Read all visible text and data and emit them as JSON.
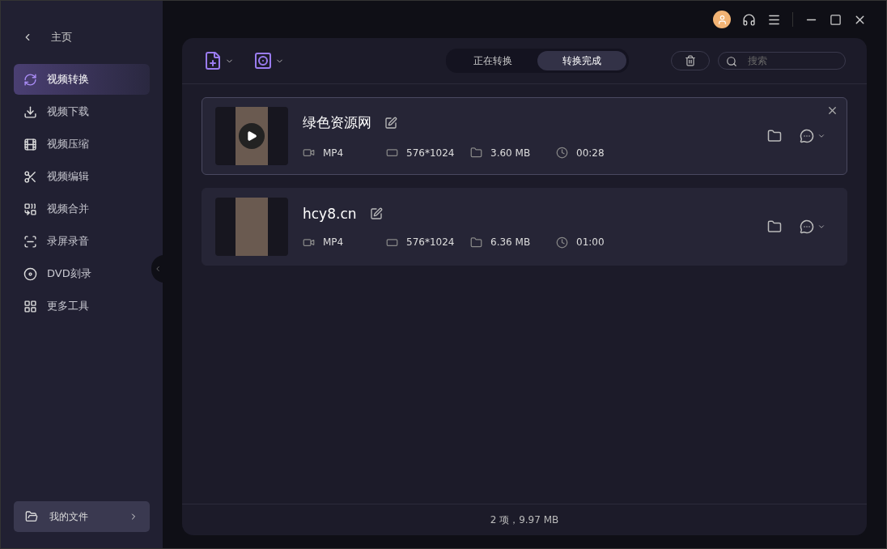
{
  "sidebar": {
    "back": {
      "label": "主页"
    },
    "items": [
      {
        "label": "视频转换",
        "selected": true
      },
      {
        "label": "视频下载",
        "selected": false
      },
      {
        "label": "视频压缩",
        "selected": false
      },
      {
        "label": "视频编辑",
        "selected": false
      },
      {
        "label": "视频合并",
        "selected": false
      },
      {
        "label": "录屏录音",
        "selected": false
      },
      {
        "label": "DVD刻录",
        "selected": false
      },
      {
        "label": "更多工具",
        "selected": false
      }
    ],
    "footer": {
      "label": "我的文件"
    }
  },
  "tabs": [
    {
      "label": "正在转换",
      "selected": false
    },
    {
      "label": "转换完成",
      "selected": true
    }
  ],
  "search": {
    "placeholder": "搜索"
  },
  "files": [
    {
      "name": "绿色资源网",
      "selected": true,
      "format": "MP4",
      "resolution": "576*1024",
      "size": "3.60 MB",
      "duration": "00:28"
    },
    {
      "name": "hcy8.cn",
      "selected": false,
      "format": "MP4",
      "resolution": "576*1024",
      "size": "6.36 MB",
      "duration": "01:00"
    }
  ],
  "status_bar": "2 项，9.97 MB"
}
